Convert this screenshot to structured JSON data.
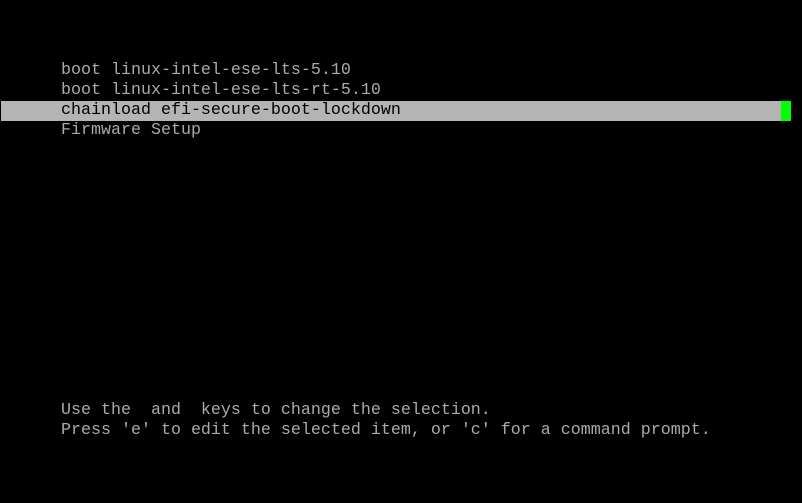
{
  "menu": {
    "items": [
      {
        "label": "boot linux-intel-ese-lts-5.10",
        "selected": false
      },
      {
        "label": "boot linux-intel-ese-lts-rt-5.10",
        "selected": false
      },
      {
        "label": "chainload efi-secure-boot-lockdown",
        "selected": true
      },
      {
        "label": "Firmware Setup",
        "selected": false
      }
    ]
  },
  "help": {
    "line1": "Use the  and  keys to change the selection.",
    "line2": "Press 'e' to edit the selected item, or 'c' for a command prompt."
  },
  "colors": {
    "text": "#aaaaaa",
    "highlight": "#b4b4b4",
    "cursor": "#00ff00",
    "background": "#000000"
  }
}
